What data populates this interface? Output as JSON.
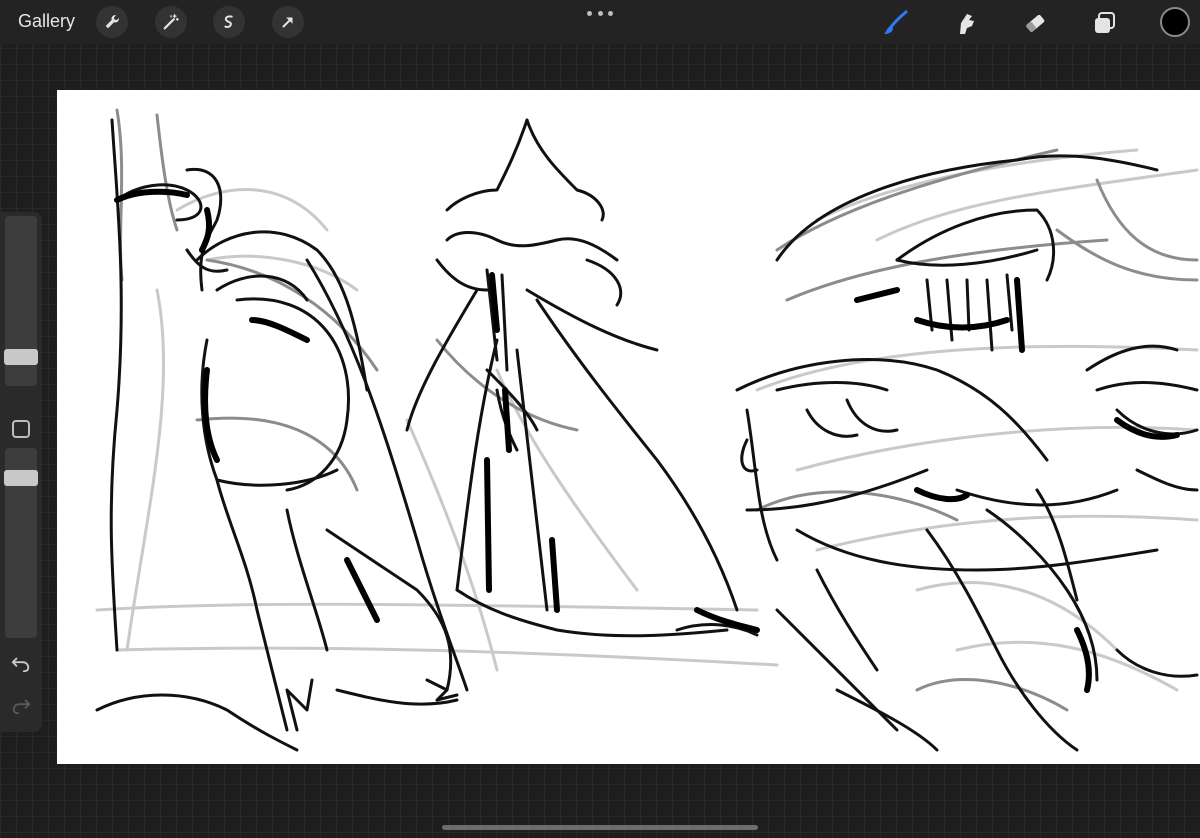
{
  "app": {
    "gallery_label": "Gallery",
    "accent_color": "#2f7bf5",
    "current_color": "#000000"
  },
  "toolbar_left": [
    {
      "name": "actions-wrench-icon"
    },
    {
      "name": "adjustments-wand-icon"
    },
    {
      "name": "selection-icon"
    },
    {
      "name": "transform-arrow-icon"
    }
  ],
  "toolbar_right": [
    {
      "name": "brush-icon",
      "active": true
    },
    {
      "name": "smudge-icon",
      "active": false
    },
    {
      "name": "eraser-icon",
      "active": false
    },
    {
      "name": "layers-icon",
      "active": false
    }
  ],
  "sidebar": {
    "brush_size_level": 0.18,
    "opacity_level": 0.95,
    "undo_icon": "undo-icon",
    "redo_icon": "redo-icon"
  },
  "canvas": {
    "content": "sketch-drawing"
  }
}
